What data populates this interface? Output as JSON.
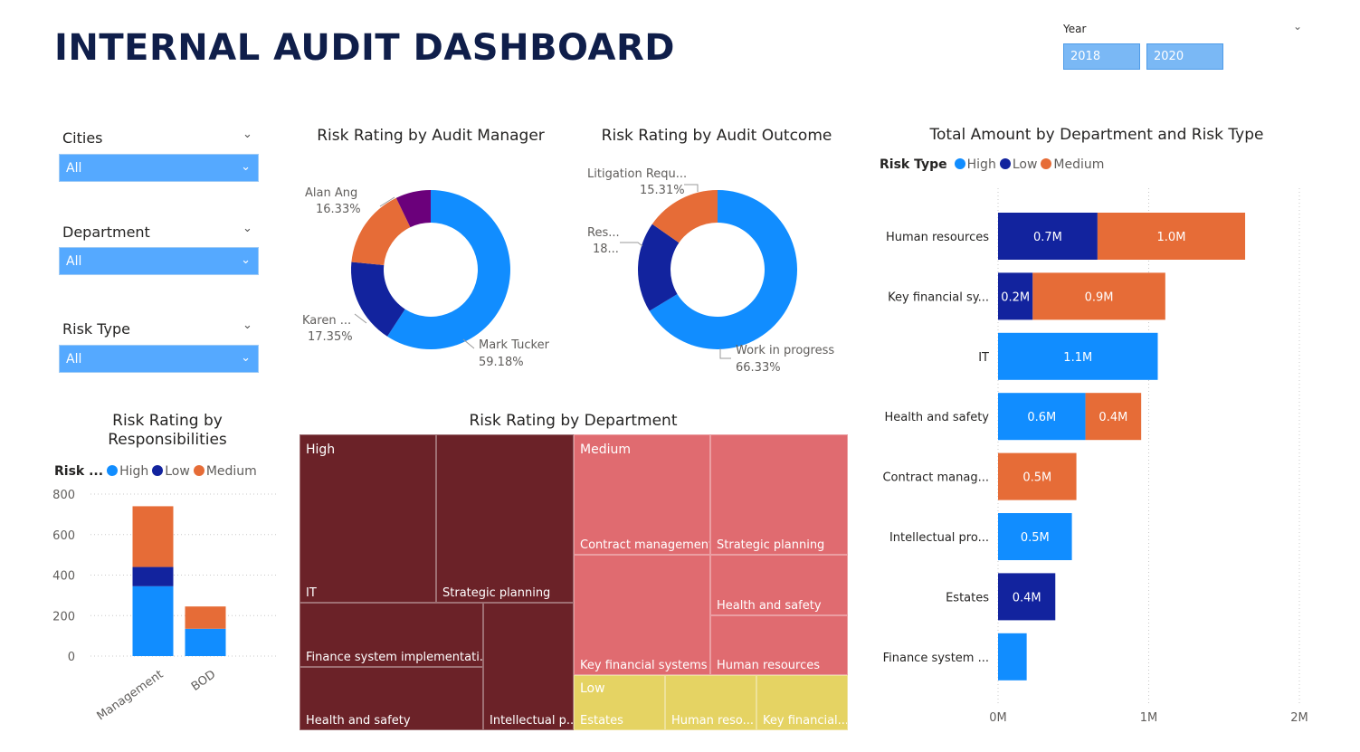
{
  "header": {
    "title": "INTERNAL AUDIT DASHBOARD"
  },
  "year_filter": {
    "label": "Year",
    "from": "2018",
    "to": "2020"
  },
  "slicers": [
    {
      "label": "Cities",
      "value": "All"
    },
    {
      "label": "Department",
      "value": "All"
    },
    {
      "label": "Risk Type",
      "value": "All"
    }
  ],
  "colors": {
    "high": "#118dff",
    "low": "#12239e",
    "medium": "#e66c37",
    "purple": "#6b007b",
    "treemap_high": "#6b2228",
    "treemap_medium": "#e06b70",
    "treemap_low": "#e5d363"
  },
  "donut_manager": {
    "title": "Risk Rating by Audit Manager",
    "slices": [
      {
        "name": "Mark Tucker",
        "pct_label": "59.18%",
        "value": 59.18,
        "color": "#118dff"
      },
      {
        "name": "Karen ...",
        "pct_label": "17.35%",
        "value": 17.35,
        "color": "#12239e"
      },
      {
        "name": "Alan Ang",
        "pct_label": "16.33%",
        "value": 16.33,
        "color": "#e66c37"
      },
      {
        "name": "",
        "pct_label": "",
        "value": 7.14,
        "color": "#6b007b"
      }
    ]
  },
  "donut_outcome": {
    "title": "Risk Rating by Audit Outcome",
    "slices": [
      {
        "name": "Work in progress",
        "pct_label": "66.33%",
        "value": 66.33,
        "color": "#118dff"
      },
      {
        "name": "Res...",
        "pct_label": "18...",
        "value": 18.36,
        "color": "#12239e"
      },
      {
        "name": "Litigation Requ...",
        "pct_label": "15.31%",
        "value": 15.31,
        "color": "#e66c37"
      }
    ]
  },
  "responsibilities": {
    "title_line1": "Risk Rating by",
    "title_line2": "Responsibilities",
    "legend_title": "Risk ...",
    "legend": [
      "High",
      "Low",
      "Medium"
    ]
  },
  "treemap": {
    "title": "Risk Rating by Department",
    "groups": {
      "high": {
        "label": "High",
        "cells": [
          "IT",
          "Strategic planning",
          "Finance system implementati...",
          "Health and safety",
          "Intellectual p..."
        ]
      },
      "medium": {
        "label": "Medium",
        "cells": [
          "Contract management",
          "Strategic planning",
          "Health and safety",
          "Key financial systems",
          "Human resources"
        ]
      },
      "low": {
        "label": "Low",
        "cells": [
          "Estates",
          "Human reso...",
          "Key financial..."
        ]
      }
    }
  },
  "amount_chart": {
    "title": "Total Amount by Department and Risk Type",
    "legend_title": "Risk Type",
    "legend": [
      "High",
      "Low",
      "Medium"
    ]
  },
  "chart_data": [
    {
      "type": "bar",
      "title": "Risk Rating by Responsibilities",
      "categories": [
        "Management",
        "BOD"
      ],
      "series": [
        {
          "name": "High",
          "values": [
            345,
            135
          ]
        },
        {
          "name": "Low",
          "values": [
            95,
            0
          ]
        },
        {
          "name": "Medium",
          "values": [
            300,
            110
          ]
        }
      ],
      "stacked": true,
      "ylim": [
        0,
        800
      ],
      "yticks": [
        "0",
        "200",
        "400",
        "600",
        "800"
      ],
      "legend_title": "Risk ...",
      "legend": "top-left",
      "grid": true
    },
    {
      "type": "bar",
      "orientation": "horizontal",
      "title": "Total Amount by Department and Risk Type",
      "categories": [
        "Human resources",
        "Key financial sy...",
        "IT",
        "Health and safety",
        "Contract manag...",
        "Intellectual pro...",
        "Estates",
        "Finance system ..."
      ],
      "series": [
        {
          "name": "High",
          "values": [
            0,
            0,
            1.06,
            0.58,
            0,
            0.49,
            0,
            0.19
          ],
          "labels": [
            "",
            "",
            "1.1M",
            "0.6M",
            "",
            "0.5M",
            "",
            ""
          ]
        },
        {
          "name": "Low",
          "values": [
            0.66,
            0.23,
            0,
            0,
            0,
            0,
            0.38,
            0
          ],
          "labels": [
            "0.7M",
            "0.2M",
            "",
            "",
            "",
            "",
            "0.4M",
            ""
          ]
        },
        {
          "name": "Medium",
          "values": [
            0.98,
            0.88,
            0,
            0.37,
            0.52,
            0,
            0,
            0
          ],
          "labels": [
            "1.0M",
            "0.9M",
            "",
            "0.4M",
            "0.5M",
            "",
            "",
            ""
          ]
        }
      ],
      "stacked": true,
      "xlim": [
        0,
        2
      ],
      "xticks": [
        "0M",
        "1M",
        "2M"
      ],
      "legend_title": "Risk Type",
      "legend": "top-left",
      "grid": true
    }
  ]
}
